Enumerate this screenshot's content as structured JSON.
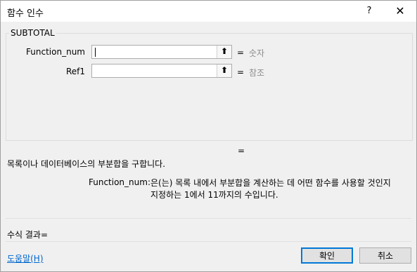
{
  "window": {
    "title": "함수 인수",
    "help_label": "?",
    "close_label": "✕"
  },
  "function_group": {
    "name": "SUBTOTAL",
    "args": [
      {
        "label": "Function_num",
        "value": "",
        "equals": "=",
        "result": "숫자"
      },
      {
        "label": "Ref1",
        "value": "",
        "equals": "=",
        "result": "참조"
      }
    ],
    "ref_button_icon": "collapse-dialog-icon",
    "ref_button_glyph": "⬆"
  },
  "result_equals": "=",
  "description": "목록이나 데이터베이스의 부분합을 구합니다.",
  "arg_description": {
    "name": "Function_num:",
    "text_line1": "은(는) 목록 내에서 부분합을 계산하는 데 어떤 함수를 사용할 것인지",
    "text_line2": "지정하는 1에서 11까지의 수입니다."
  },
  "formula_result": "수식 결과=",
  "help_link": "도움말(H)",
  "buttons": {
    "ok": "확인",
    "cancel": "취소"
  },
  "colors": {
    "link": "#0066cc",
    "default_border": "#0078d7"
  }
}
